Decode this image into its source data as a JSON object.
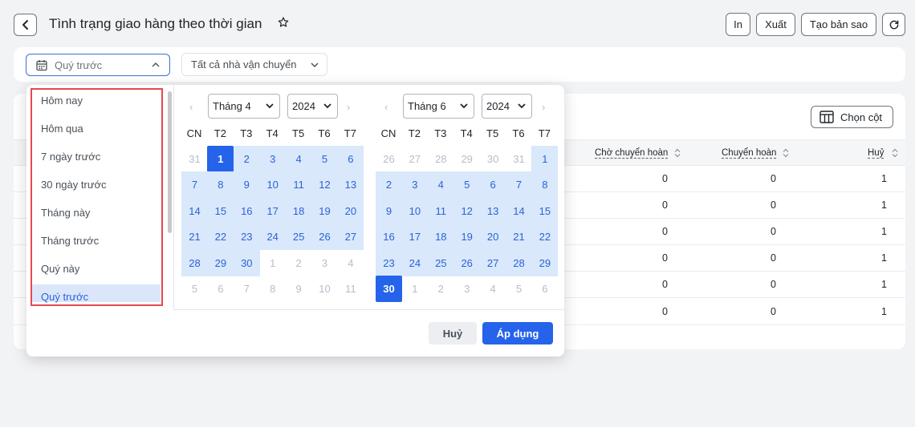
{
  "header": {
    "title": "Tình trạng giao hàng theo thời gian",
    "print_label": "In",
    "export_label": "Xuất",
    "copy_label": "Tạo bản sao"
  },
  "filters": {
    "date_range": "Quý trước",
    "carrier": "Tất cả nhà vận chuyển"
  },
  "table": {
    "choose_columns_label": "Chọn cột",
    "columns": [
      "Chờ chuyển hoàn",
      "Chuyển hoàn",
      "Huỷ"
    ],
    "rows": [
      [
        "0",
        "0",
        "1"
      ],
      [
        "0",
        "0",
        "1"
      ],
      [
        "0",
        "0",
        "1"
      ],
      [
        "0",
        "0",
        "1"
      ],
      [
        "0",
        "0",
        "1"
      ],
      [
        "0",
        "0",
        "1"
      ]
    ]
  },
  "datepicker": {
    "presets": [
      "Hôm nay",
      "Hôm qua",
      "7 ngày trước",
      "30 ngày trước",
      "Tháng này",
      "Tháng trước",
      "Quý này",
      "Quý trước"
    ],
    "selected_preset": "Quý trước",
    "weekdays": [
      "CN",
      "T2",
      "T3",
      "T4",
      "T5",
      "T6",
      "T7"
    ],
    "left": {
      "month": "Tháng 4",
      "year": "2024",
      "days": [
        [
          "31",
          "1",
          "2",
          "3",
          "4",
          "5",
          "6"
        ],
        [
          "7",
          "8",
          "9",
          "10",
          "11",
          "12",
          "13"
        ],
        [
          "14",
          "15",
          "16",
          "17",
          "18",
          "19",
          "20"
        ],
        [
          "21",
          "22",
          "23",
          "24",
          "25",
          "26",
          "27"
        ],
        [
          "28",
          "29",
          "30",
          "1",
          "2",
          "3",
          "4"
        ],
        [
          "5",
          "6",
          "7",
          "8",
          "9",
          "10",
          "11"
        ]
      ]
    },
    "right": {
      "month": "Tháng 6",
      "year": "2024",
      "days": [
        [
          "26",
          "27",
          "28",
          "29",
          "30",
          "31",
          "1"
        ],
        [
          "2",
          "3",
          "4",
          "5",
          "6",
          "7",
          "8"
        ],
        [
          "9",
          "10",
          "11",
          "12",
          "13",
          "14",
          "15"
        ],
        [
          "16",
          "17",
          "18",
          "19",
          "20",
          "21",
          "22"
        ],
        [
          "23",
          "24",
          "25",
          "26",
          "27",
          "28",
          "29"
        ],
        [
          "30",
          "1",
          "2",
          "3",
          "4",
          "5",
          "6"
        ]
      ]
    },
    "cancel_label": "Huỷ",
    "apply_label": "Áp dụng"
  },
  "colors": {
    "accent": "#2563eb",
    "range_bg": "#d9e8fb",
    "highlight_border": "#e5484d"
  }
}
